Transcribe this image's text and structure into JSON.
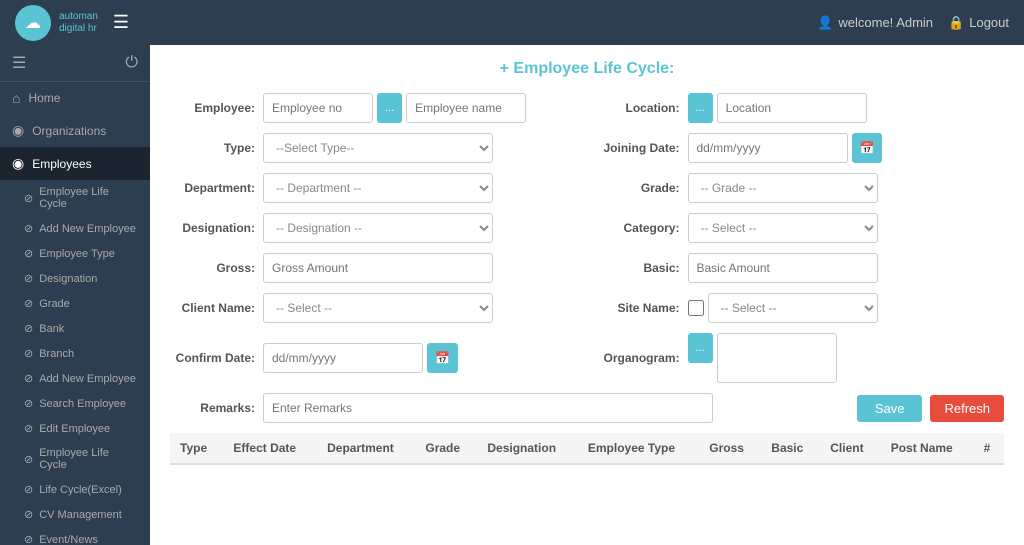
{
  "topbar": {
    "hamburger_label": "☰",
    "brand_name": "automan\ndigital hr",
    "welcome_label": "welcome! Admin",
    "logout_label": "Logout"
  },
  "sidebar": {
    "icons": {
      "hamburger": "☰",
      "power": "⏻"
    },
    "items": [
      {
        "id": "home",
        "icon": "⌂",
        "label": "Home"
      },
      {
        "id": "organizations",
        "icon": "◉",
        "label": "Organizations"
      },
      {
        "id": "employees",
        "icon": "◉",
        "label": "Employees",
        "active": true
      },
      {
        "id": "employee-life-cycle",
        "icon": "⊘",
        "label": "Employee Life Cycle"
      },
      {
        "id": "add-new-employee",
        "icon": "⊘",
        "label": "Add New Employee"
      },
      {
        "id": "employee-type",
        "icon": "⊘",
        "label": "Employee Type"
      },
      {
        "id": "designation",
        "icon": "⊘",
        "label": "Designation"
      },
      {
        "id": "grade",
        "icon": "⊘",
        "label": "Grade"
      },
      {
        "id": "bank",
        "icon": "⊘",
        "label": "Bank"
      },
      {
        "id": "branch",
        "icon": "⊘",
        "label": "Branch"
      },
      {
        "id": "add-new-employee2",
        "icon": "⊘",
        "label": "Add New Employee"
      },
      {
        "id": "search-employee",
        "icon": "⊘",
        "label": "Search Employee"
      },
      {
        "id": "edit-employee",
        "icon": "⊘",
        "label": "Edit Employee"
      },
      {
        "id": "employee-life-cycle2",
        "icon": "⊘",
        "label": "Employee Life Cycle"
      },
      {
        "id": "life-cycle-excel",
        "icon": "⊘",
        "label": "Life Cycle(Excel)"
      },
      {
        "id": "cv-management",
        "icon": "⊘",
        "label": "CV Management"
      },
      {
        "id": "event-news",
        "icon": "⊘",
        "label": "Event/News"
      }
    ]
  },
  "form": {
    "title": "+ Employee Life Cycle:",
    "employee_label": "Employee:",
    "employee_no_placeholder": "Employee no",
    "employee_name_placeholder": "Employee name",
    "location_label": "Location:",
    "location_placeholder": "Location",
    "type_label": "Type:",
    "type_options": [
      "--Select Type--"
    ],
    "joining_date_label": "Joining Date:",
    "joining_date_placeholder": "dd/mm/yyyy",
    "department_label": "Department:",
    "department_options": [
      "-- Department --"
    ],
    "grade_label": "Grade:",
    "grade_options": [
      "-- Grade --"
    ],
    "designation_label": "Designation:",
    "designation_options": [
      "-- Designation --"
    ],
    "category_label": "Category:",
    "category_options": [
      "-- Select --"
    ],
    "gross_label": "Gross:",
    "gross_placeholder": "Gross Amount",
    "basic_label": "Basic:",
    "basic_placeholder": "Basic Amount",
    "client_name_label": "Client Name:",
    "client_name_options": [
      "-- Select --"
    ],
    "site_name_label": "Site Name:",
    "site_name_options": [
      "-- Select --"
    ],
    "confirm_date_label": "Confirm Date:",
    "confirm_date_placeholder": "dd/mm/yyyy",
    "organogram_label": "Organogram:",
    "remarks_label": "Remarks:",
    "remarks_placeholder": "Enter Remarks",
    "save_label": "Save",
    "refresh_label": "Refresh",
    "btn_ellipsis": "..."
  },
  "table": {
    "columns": [
      "Type",
      "Effect Date",
      "Department",
      "Grade",
      "Designation",
      "Employee Type",
      "Gross",
      "Basic",
      "Client",
      "Post Name",
      "#"
    ]
  }
}
